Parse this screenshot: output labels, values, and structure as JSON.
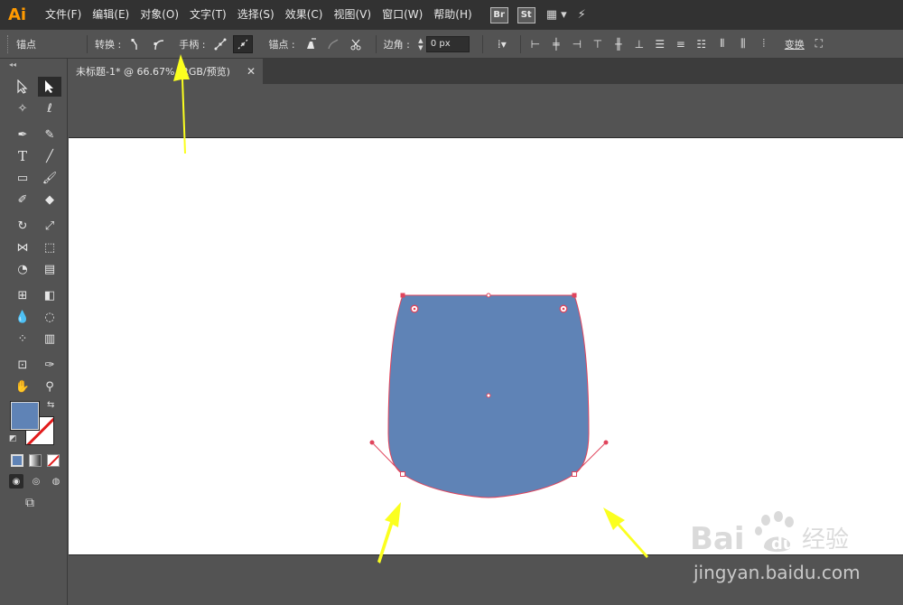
{
  "app": {
    "logo": "Ai"
  },
  "menu": {
    "items": [
      "文件(F)",
      "编辑(E)",
      "对象(O)",
      "文字(T)",
      "选择(S)",
      "效果(C)",
      "视图(V)",
      "窗口(W)",
      "帮助(H)"
    ],
    "bridge": "Br",
    "stock": "St"
  },
  "control": {
    "context": "锚点",
    "convert_label": "转换 :",
    "handles_label": "手柄 :",
    "anchors_label": "锚点 :",
    "corner_label": "边角 :",
    "corner_value": "0 px",
    "transform_label": "变换"
  },
  "document": {
    "tab_title": "未标题-1* @ 66.67% (RGB/预览)"
  },
  "colors": {
    "fill": "#5f83b6",
    "path": "#e0445c",
    "arrow": "#fbff1f",
    "accent_logo": "#ff9a00"
  },
  "watermark": {
    "brand": "Bai du 经验",
    "url": "jingyan.baidu.com"
  }
}
